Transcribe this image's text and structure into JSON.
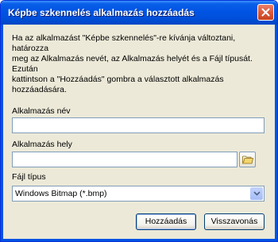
{
  "window": {
    "title": "Képbe szkennelés alkalmazás hozzáadás"
  },
  "description": {
    "line1": "Ha az alkalmazást \"Képbe szkennelés\"-re kívánja változtani, határozza",
    "line2": "meg az Alkalmazás nevét, az Alkalmazás helyét és a Fájl típusát. Ezután",
    "line3": "kattintson a \"Hozzáadás\" gombra a választott alkalmazás hozzáadására."
  },
  "form": {
    "app_name_label": "Alkalmazás név",
    "app_name_value": "",
    "app_location_label": "Alkalmazás hely",
    "app_location_value": "",
    "file_type_label": "Fájl típus",
    "file_type_selected": "Windows Bitmap (*.bmp)"
  },
  "buttons": {
    "add_label": "Hozzáadás",
    "cancel_label": "Visszavonás"
  },
  "icons": {
    "close": "close-icon",
    "browse": "folder-icon",
    "dropdown": "chevron-down-icon"
  }
}
